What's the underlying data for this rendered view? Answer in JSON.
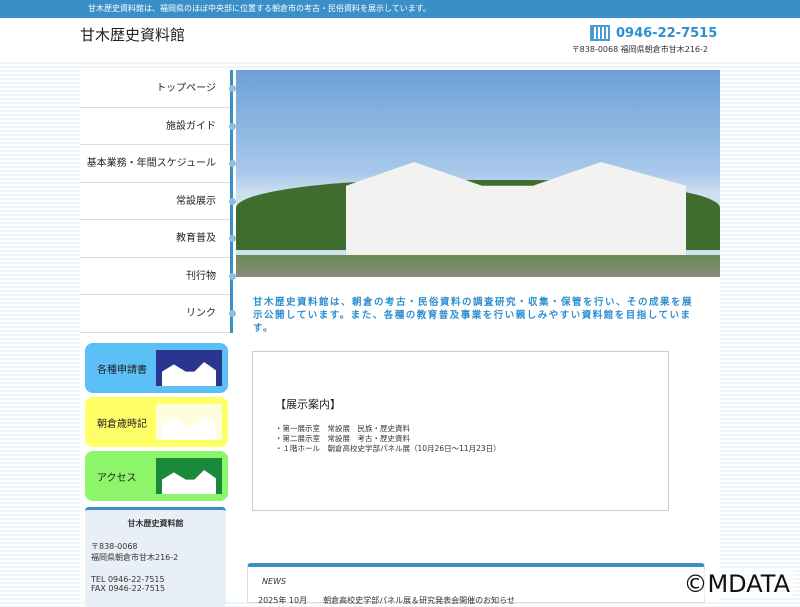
{
  "topbar": {
    "text": "甘木歴史資料館は、福岡県のほぼ中央部に位置する朝倉市の考古・民俗資料を展示しています。"
  },
  "header": {
    "logo": "甘木歴史資料館",
    "tel": "0946-22-7515",
    "address": "〒838-0068 福岡県朝倉市甘木216-2"
  },
  "nav": [
    "トップページ",
    "施設ガイド",
    "基本業務・年間スケジュール",
    "常設展示",
    "教育普及",
    "刊行物",
    "リンク"
  ],
  "banners": [
    {
      "label": "各種申請書",
      "bg": "#5bc0f5",
      "pic": "#2a3590"
    },
    {
      "label": "朝倉歳時記",
      "bg": "#ffff66",
      "pic": "#fffde0"
    },
    {
      "label": "アクセス",
      "bg": "#8cf56a",
      "pic": "#1a8a3a"
    }
  ],
  "info": {
    "title": "甘木歴史資料館",
    "zip": "〒838-0068",
    "address": "福岡県朝倉市甘木216-2",
    "tel": "TEL 0946-22-7515",
    "fax": "FAX 0946-22-7515"
  },
  "intro": "甘木歴史資料館は、朝倉の考古・民俗資料の調査研究・収集・保管を行い、その成果を展示公開しています。また、各種の教育普及事業を行い親しみやすい資料館を目指しています。",
  "exhibit": {
    "title": "【展示案内】",
    "items": [
      "・第一展示室　常設展　民族・歴史資料",
      "・第二展示室　常設展　考古・歴史資料",
      "・１階ホール　朝倉高校史学部パネル展（10月26日～11月23日）"
    ]
  },
  "news": {
    "heading": "NEWS",
    "item": "2025年 10月　　朝倉高校史学部パネル展＆研究発表会開催のお知らせ"
  },
  "watermark": "©MDATA"
}
